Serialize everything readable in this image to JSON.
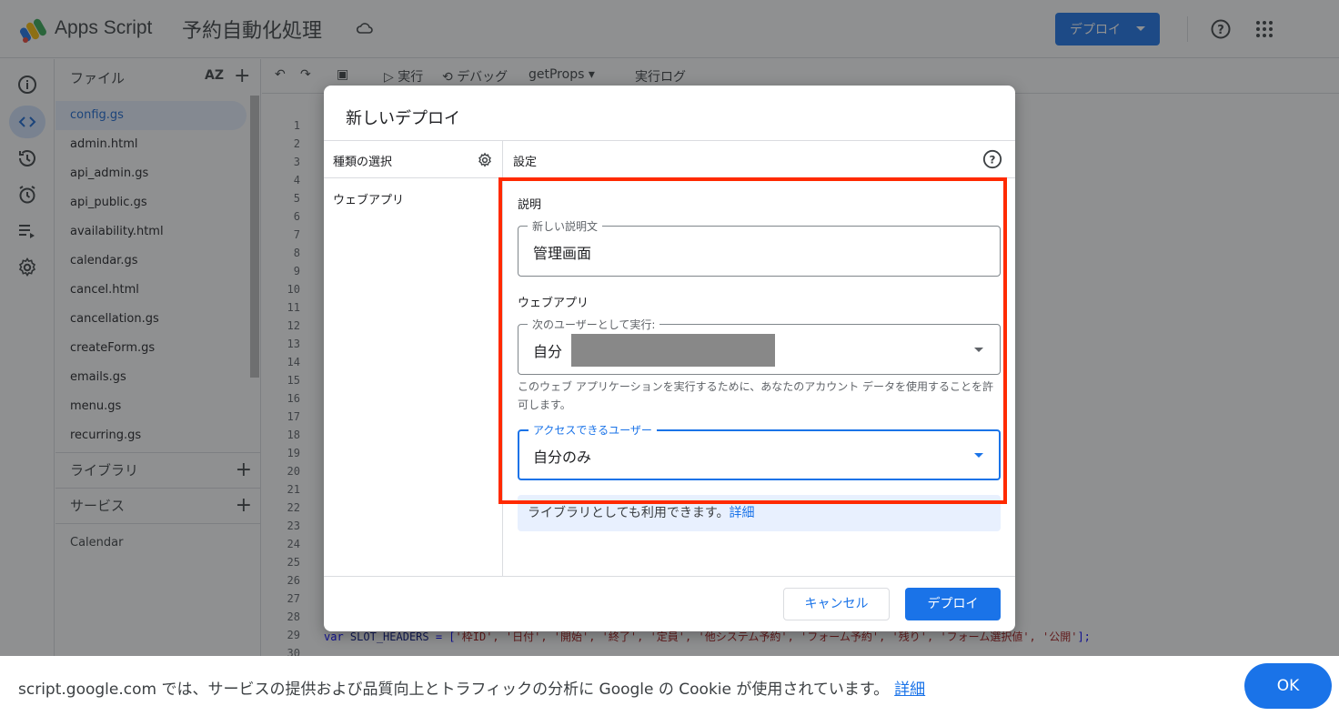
{
  "header": {
    "app_name": "Apps Script",
    "project_title": "予約自動化処理",
    "deploy_label": "デプロイ"
  },
  "files": {
    "title": "ファイル",
    "sort_label": "AZ",
    "items": [
      "config.gs",
      "admin.html",
      "api_admin.gs",
      "api_public.gs",
      "availability.html",
      "calendar.gs",
      "cancel.html",
      "cancellation.gs",
      "createForm.gs",
      "emails.gs",
      "menu.gs",
      "recurring.gs"
    ],
    "libraries_label": "ライブラリ",
    "services_label": "サービス",
    "services_items": [
      "Calendar"
    ]
  },
  "toolbar": {
    "run": "実行",
    "debug": "デバッグ",
    "function": "getProps",
    "log": "実行ログ"
  },
  "editor": {
    "line_numbers": [
      "1",
      "2",
      "3",
      "4",
      "5",
      "6",
      "7",
      "8",
      "9",
      "10",
      "11",
      "12",
      "13",
      "14",
      "15",
      "16",
      "17",
      "18",
      "19",
      "20",
      "21",
      "22",
      "23",
      "24",
      "25",
      "26",
      "27",
      "28",
      "29",
      "30"
    ],
    "line29": {
      "keyword": "var",
      "name": "SLOT_HEADERS",
      "assign": " = [",
      "values": "'枠ID', '日付', '開始', '終了', '定員', '他システム予約', 'フォーム予約', '残り', 'フォーム選択値', '公開'",
      "end": "];"
    }
  },
  "dialog": {
    "title": "新しいデプロイ",
    "type_select_label": "種類の選択",
    "type_item": "ウェブアプリ",
    "settings_label": "設定",
    "description_section": "説明",
    "description_field_label": "新しい説明文",
    "description_value": "管理画面",
    "webapp_section": "ウェブアプリ",
    "execute_as_label": "次のユーザーとして実行:",
    "execute_as_value": "自分",
    "execute_help": "このウェブ アプリケーションを実行するために、あなたのアカウント データを使用することを許可します。",
    "access_label": "アクセスできるユーザー",
    "access_value": "自分のみ",
    "info_text": "ライブラリとしても利用できます。",
    "info_link": "詳細",
    "cancel_label": "キャンセル",
    "deploy_label": "デプロイ"
  },
  "cookie": {
    "text": "script.google.com では、サービスの提供および品質向上とトラフィックの分析に Google の Cookie が使用されています。",
    "link": "詳細",
    "ok": "OK"
  },
  "colors": {
    "accent": "#1a73e8",
    "highlight": "#ff2a00"
  }
}
